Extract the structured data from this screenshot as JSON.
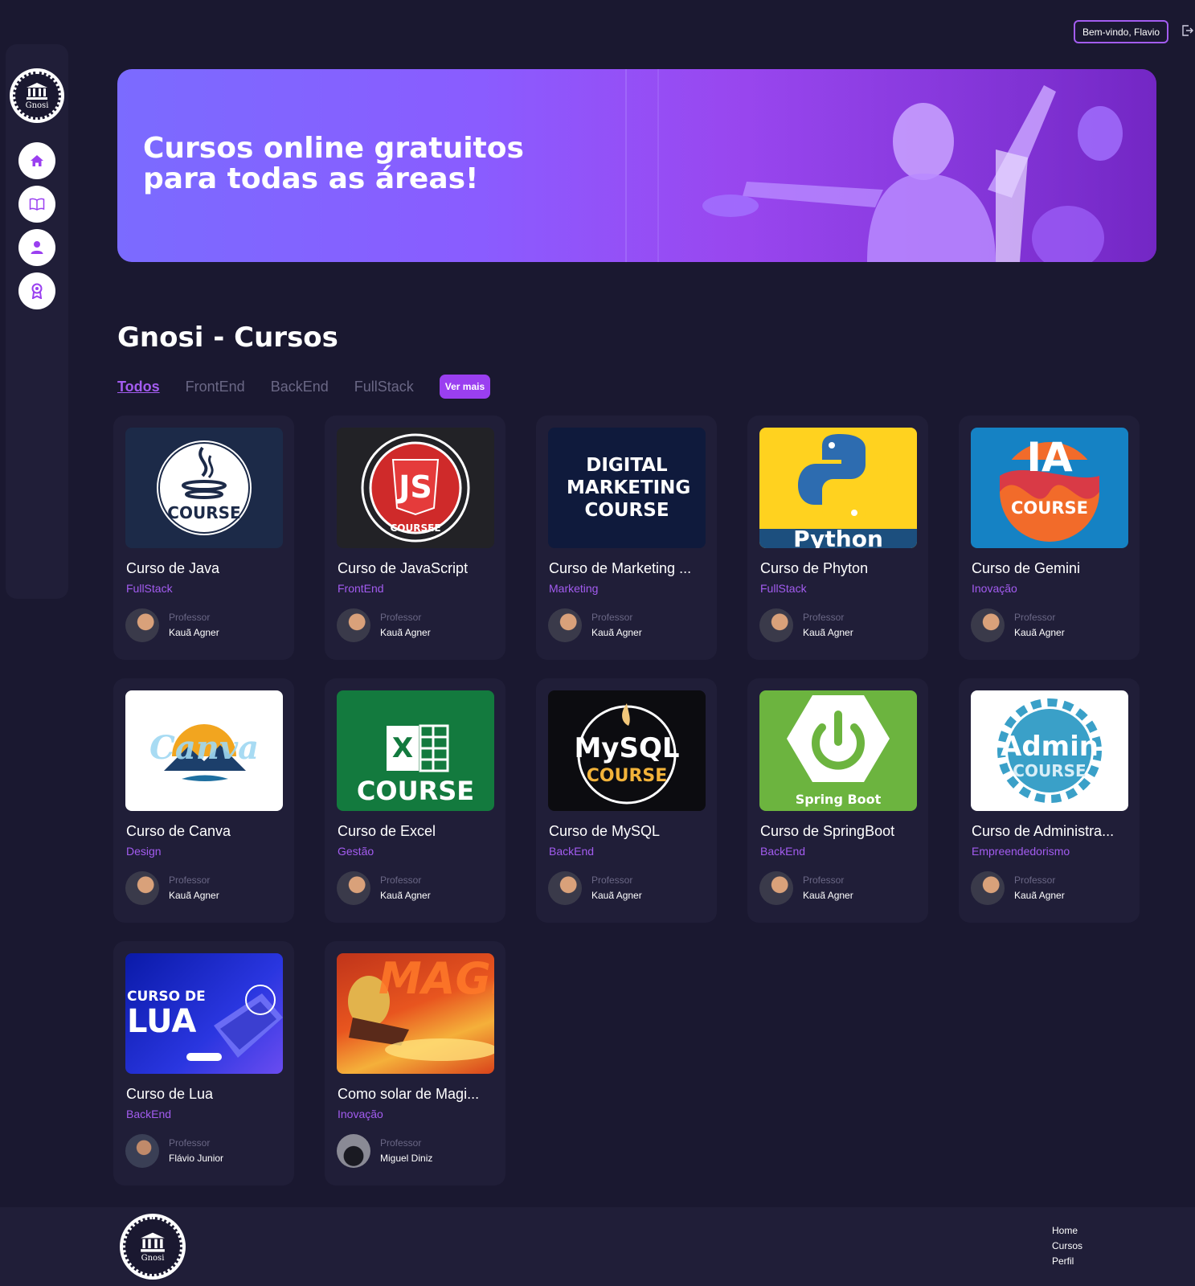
{
  "brand": {
    "logo_text": "Gnosi"
  },
  "header": {
    "welcome": "Bem-vindo, Flavio"
  },
  "sidebar": {
    "items": [
      {
        "icon": "home-icon"
      },
      {
        "icon": "book-icon"
      },
      {
        "icon": "user-icon"
      },
      {
        "icon": "certificate-icon"
      }
    ]
  },
  "hero": {
    "title": "Cursos online gratuitos para todas as áreas!"
  },
  "section": {
    "title": "Gnosi - Cursos",
    "tabs": [
      "Todos",
      "FrontEnd",
      "BackEnd",
      "FullStack"
    ],
    "more": "Ver mais"
  },
  "professor_label": "Professor",
  "courses": [
    {
      "title": "Curso de Java",
      "category": "FullStack",
      "professor": "Kauã Agner",
      "thumb_text": "COURSE"
    },
    {
      "title": "Curso de JavaScript",
      "category": "FrontEnd",
      "professor": "Kauã Agner",
      "thumb_text": "JS",
      "thumb_sub": "COURSEE"
    },
    {
      "title": "Curso de Marketing ...",
      "category": "Marketing",
      "professor": "Kauã Agner",
      "thumb_text": "DIGITAL MARKETING COURSE"
    },
    {
      "title": "Curso de Phyton",
      "category": "FullStack",
      "professor": "Kauã Agner",
      "thumb_text": "Python"
    },
    {
      "title": "Curso de Gemini",
      "category": "Inovação",
      "professor": "Kauã Agner",
      "thumb_text": "IA",
      "thumb_sub": "COURSE"
    },
    {
      "title": "Curso de Canva",
      "category": "Design",
      "professor": "Kauã Agner",
      "thumb_text": "Canva"
    },
    {
      "title": "Curso de Excel",
      "category": "Gestão",
      "professor": "Kauã Agner",
      "thumb_text": "X",
      "thumb_sub": "COURSE"
    },
    {
      "title": "Curso de MySQL",
      "category": "BackEnd",
      "professor": "Kauã Agner",
      "thumb_text": "MySQL",
      "thumb_sub": "COURSE"
    },
    {
      "title": "Curso de SpringBoot",
      "category": "BackEnd",
      "professor": "Kauã Agner",
      "thumb_text": "Spring Boot"
    },
    {
      "title": "Curso de Administra...",
      "category": "Empreendedorismo",
      "professor": "Kauã Agner",
      "thumb_text": "Admin",
      "thumb_sub": "COURSE"
    },
    {
      "title": "Curso de Lua",
      "category": "BackEnd",
      "professor": "Flávio Junior",
      "thumb_text": "CURSO DE",
      "thumb_sub": "LUA"
    },
    {
      "title": "Como solar de Magi...",
      "category": "Inovação",
      "professor": "Miguel Diniz",
      "thumb_text": "MAGI"
    }
  ],
  "footer": {
    "links": [
      "Home",
      "Cursos",
      "Perfil"
    ]
  },
  "colors": {
    "background": "#1a1830",
    "panel": "#201e38",
    "accent": "#a35cf0"
  }
}
